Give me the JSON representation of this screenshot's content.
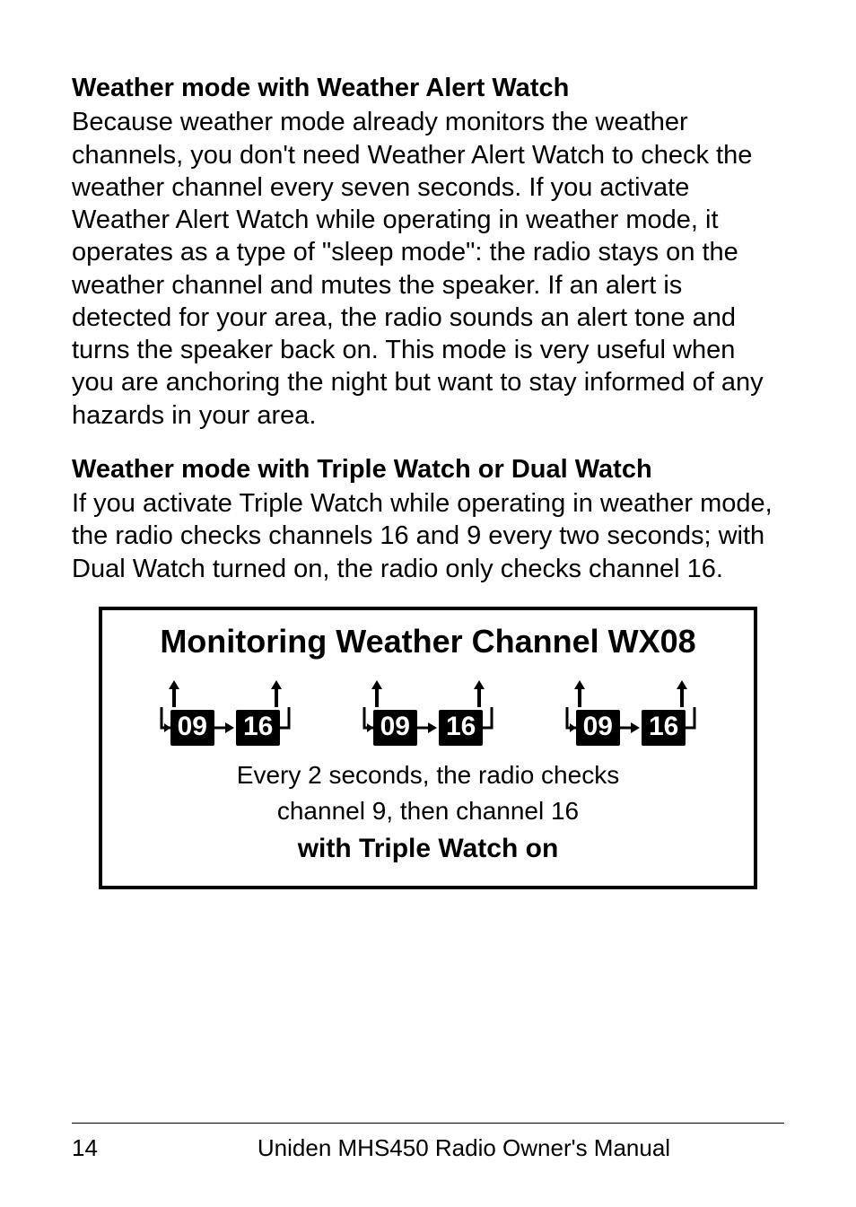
{
  "section1": {
    "heading": "Weather mode with Weather Alert Watch",
    "body": "Because weather mode already monitors the weather channels, you don't need Weather Alert Watch to check the weather channel every seven seconds. If you activate Weather Alert Watch while operating in weather mode, it operates as a type of \"sleep mode\": the radio stays on the weather channel and mutes the speaker. If an alert is detected for your area, the radio sounds an alert tone and turns the speaker back on. This mode is very useful when you are anchoring the night but want to stay informed of any hazards in your area."
  },
  "section2": {
    "heading": "Weather mode with Triple Watch or Dual Watch",
    "body": "If you activate Triple Watch while operating in weather mode, the radio checks channels 16 and 9 every two seconds; with Dual Watch turned on, the radio only checks channel 16."
  },
  "figure": {
    "title": "Monitoring Weather Channel WX08",
    "groups": [
      {
        "a": "09",
        "b": "16"
      },
      {
        "a": "09",
        "b": "16"
      },
      {
        "a": "09",
        "b": "16"
      }
    ],
    "caption_line1": "Every 2 seconds, the radio checks",
    "caption_line2": "channel 9, then channel 16",
    "caption_bold": "with Triple Watch on"
  },
  "footer": {
    "page": "14",
    "title": "Uniden MHS450 Radio Owner's Manual"
  }
}
